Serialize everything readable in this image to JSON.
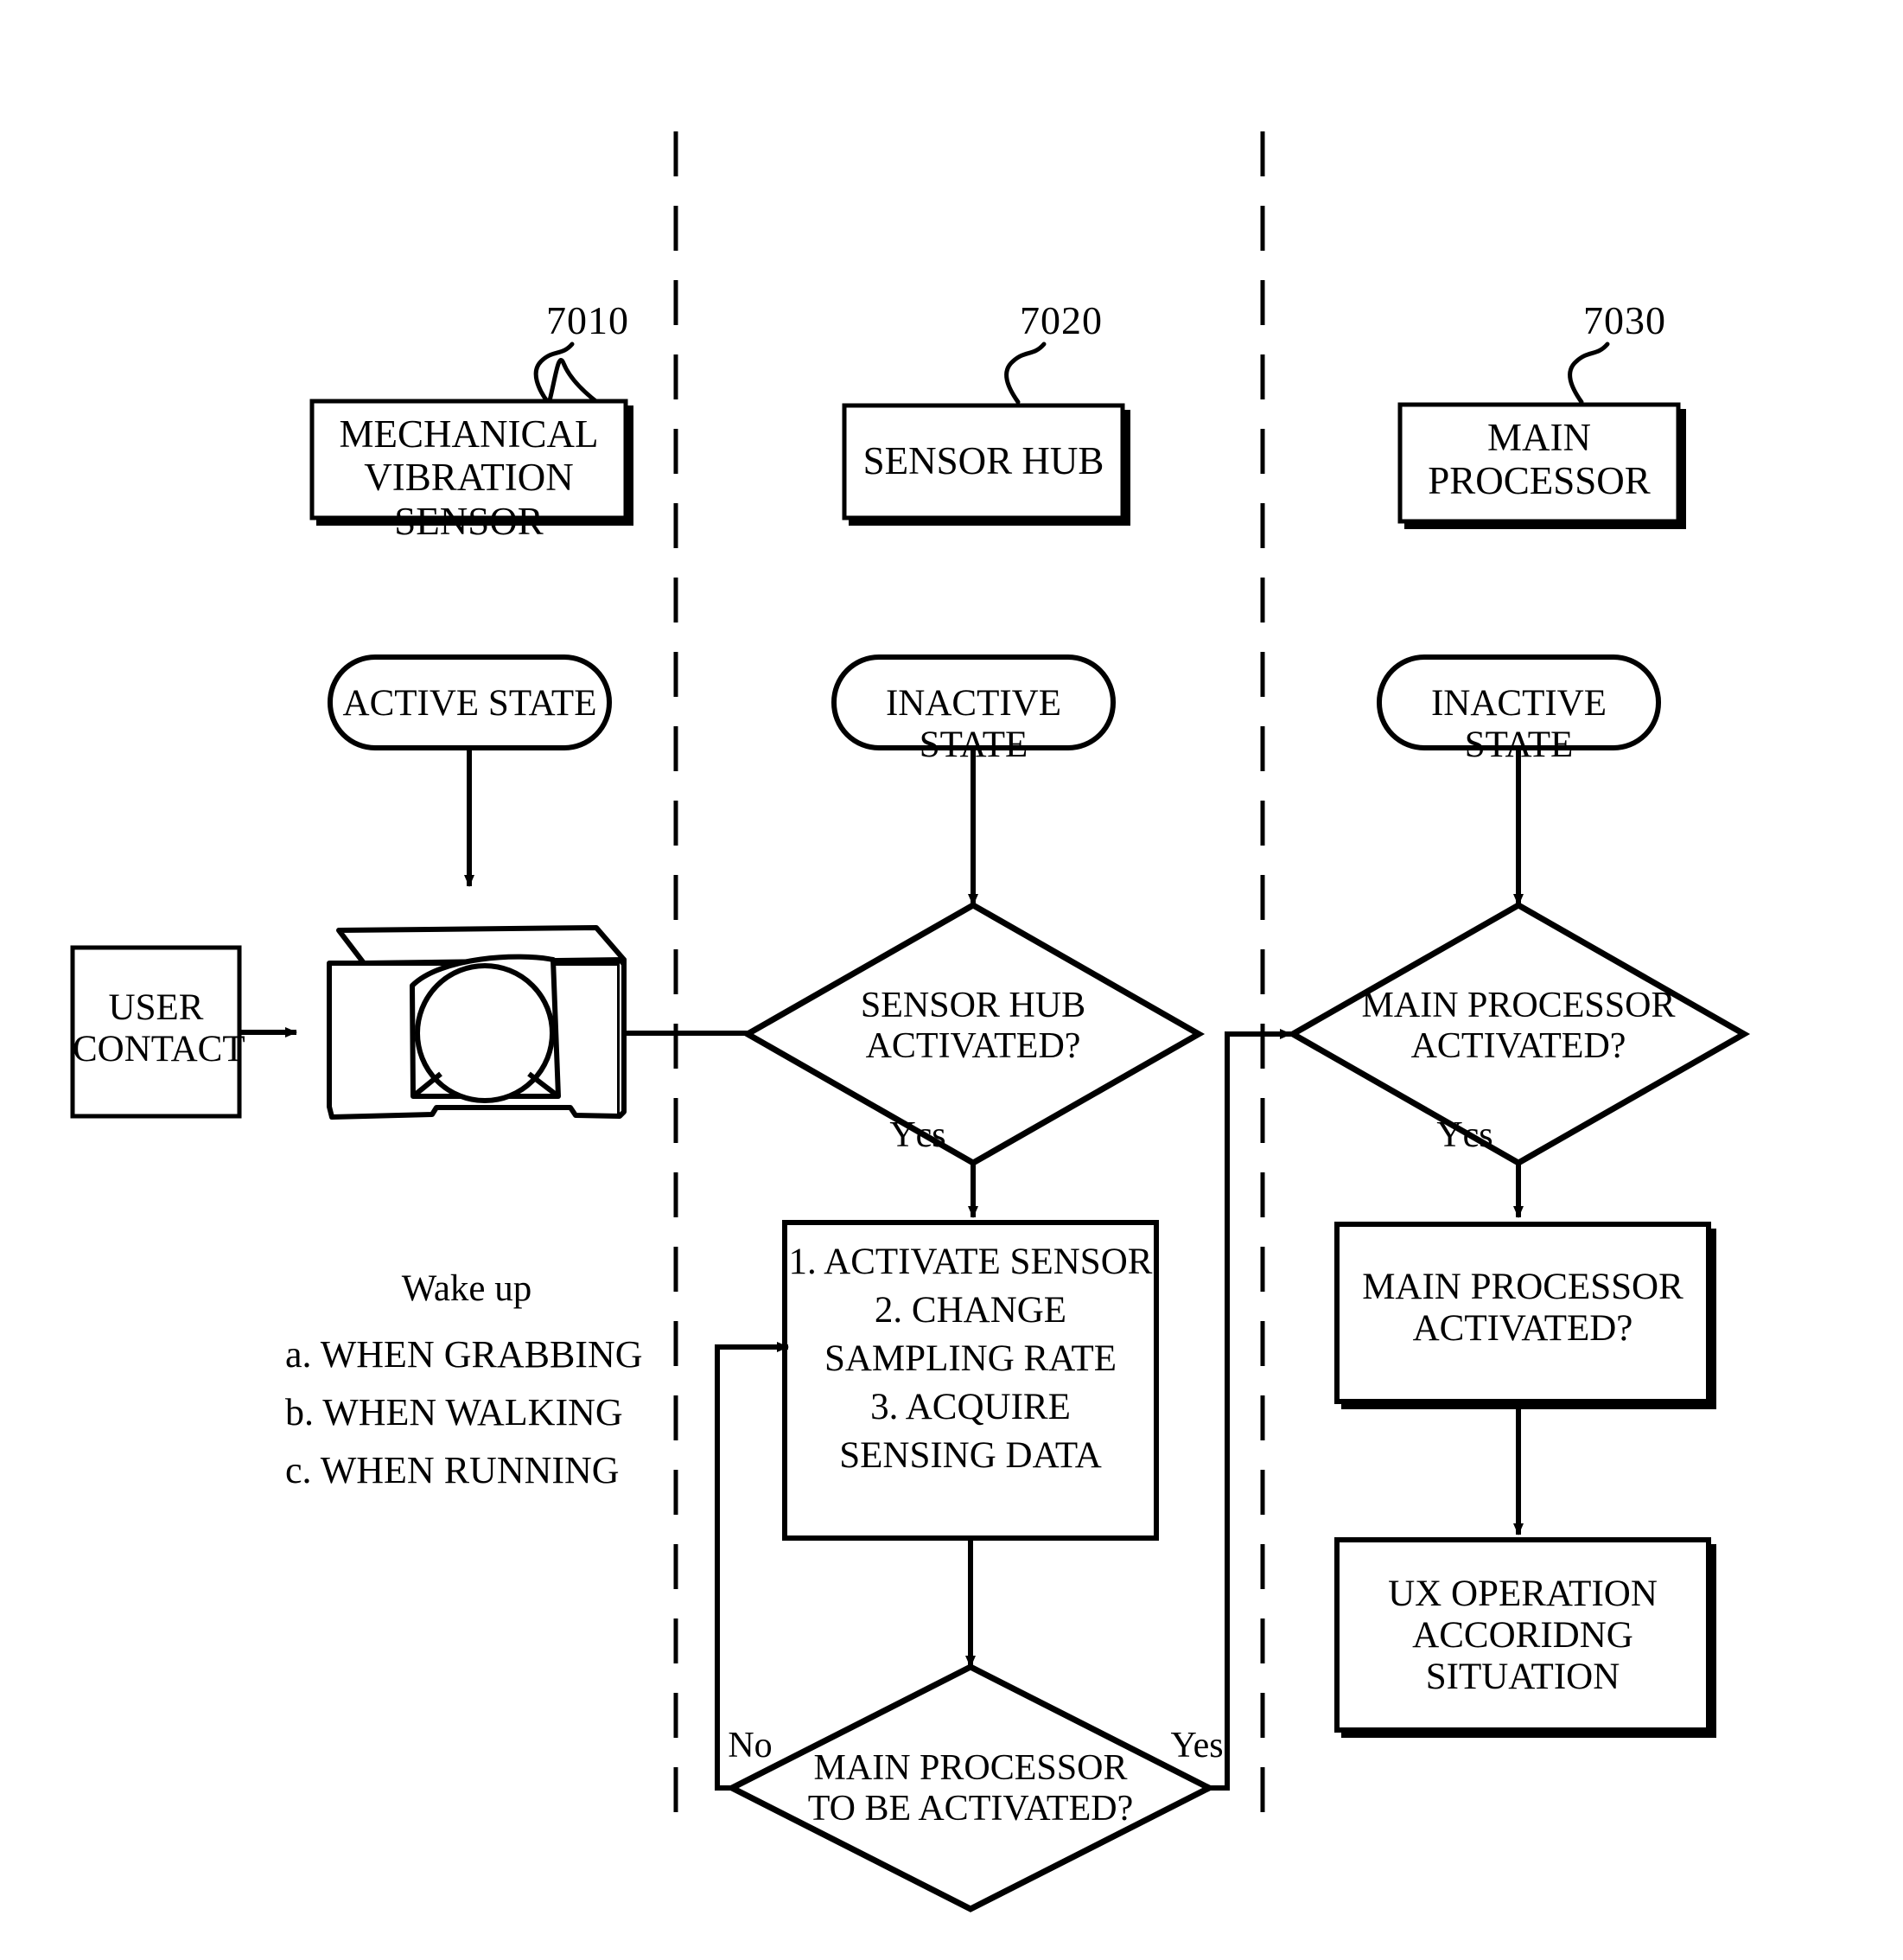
{
  "figure": {
    "type": "patent-flowchart",
    "reference_numerals": [
      {
        "id": "7010",
        "label": "7010"
      },
      {
        "id": "7020",
        "label": "7020"
      },
      {
        "id": "7030",
        "label": "7030"
      }
    ]
  },
  "columns": [
    {
      "key": "mechanical_vibration_sensor",
      "header": "MECHANICAL\nVIBRATION SENSOR",
      "ref": "7010",
      "state": "ACTIVE STATE"
    },
    {
      "key": "sensor_hub",
      "header": "SENSOR HUB",
      "ref": "7020",
      "state": "INACTIVE STATE"
    },
    {
      "key": "main_processor",
      "header": "MAIN\nPROCESSOR",
      "ref": "7030",
      "state": "INACTIVE STATE"
    }
  ],
  "left_column": {
    "user_contact_box": "USER\nCONTACT",
    "sensor_device_icon": "mechanical-vibration-sensor-illustration",
    "wake_up": {
      "title": "Wake up",
      "items": [
        "a. WHEN GRABBING",
        "b. WHEN WALKING",
        "c. WHEN RUNNING"
      ]
    }
  },
  "middle_column": {
    "decision_sensor_hub": "SENSOR HUB\nACTIVATED?",
    "yes_label": "Ycs",
    "process_steps": "1. ACTIVATE SENSOR\n2. CHANGE\nSAMPLING RATE\n3. ACQUIRE\nSENSING DATA",
    "decision_main_processor": "MAIN PROCESSOR\nTO BE ACTIVATED?",
    "no_label": "No",
    "yes_exit_label": "Yes"
  },
  "right_column": {
    "decision_main_processor": "MAIN PROCESSOR\nACTIVATED?",
    "yes_label": "Ycs",
    "box_main_processor_activated": "MAIN PROCESSOR\nACTIVATED?",
    "box_ux_operation": "UX OPERATION\nACCORIDNG\nSITUATION"
  },
  "colors": {
    "ink": "#000000",
    "paper": "#ffffff"
  }
}
